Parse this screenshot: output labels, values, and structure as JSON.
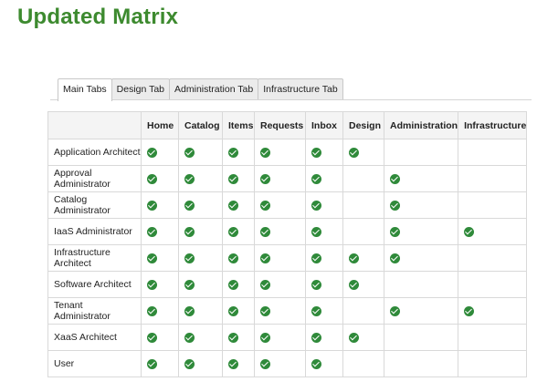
{
  "title": "Updated Matrix",
  "tabs": [
    "Main Tabs",
    "Design Tab",
    "Administration Tab",
    "Infrastructure Tab"
  ],
  "active_tab": 0,
  "columns": [
    "Home",
    "Catalog",
    "Items",
    "Requests",
    "Inbox",
    "Design",
    "Administration",
    "Infrastructure"
  ],
  "rows": [
    {
      "role": "Application Architect",
      "checks": [
        true,
        true,
        true,
        true,
        true,
        true,
        false,
        false
      ]
    },
    {
      "role": "Approval Administrator",
      "checks": [
        true,
        true,
        true,
        true,
        true,
        false,
        true,
        false
      ]
    },
    {
      "role": "Catalog Administrator",
      "checks": [
        true,
        true,
        true,
        true,
        true,
        false,
        true,
        false
      ]
    },
    {
      "role": "IaaS Administrator",
      "checks": [
        true,
        true,
        true,
        true,
        true,
        false,
        true,
        true
      ]
    },
    {
      "role": "Infrastructure Architect",
      "checks": [
        true,
        true,
        true,
        true,
        true,
        true,
        true,
        false
      ]
    },
    {
      "role": "Software Architect",
      "checks": [
        true,
        true,
        true,
        true,
        true,
        true,
        false,
        false
      ]
    },
    {
      "role": "Tenant Administrator",
      "checks": [
        true,
        true,
        true,
        true,
        true,
        false,
        true,
        true
      ]
    },
    {
      "role": "XaaS Architect",
      "checks": [
        true,
        true,
        true,
        true,
        true,
        true,
        false,
        false
      ]
    },
    {
      "role": "User",
      "checks": [
        true,
        true,
        true,
        true,
        true,
        false,
        false,
        false
      ]
    }
  ],
  "colors": {
    "title": "#3d8a2f",
    "check": "#2f8a3a"
  },
  "icons": {
    "check": "check-circle-icon"
  }
}
